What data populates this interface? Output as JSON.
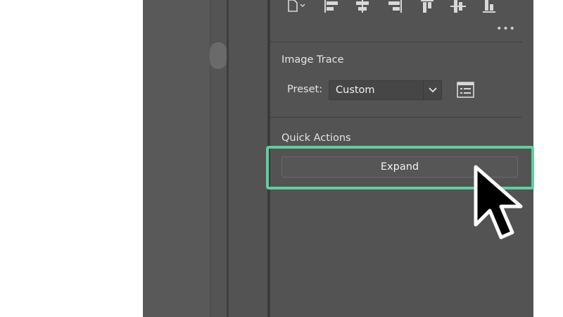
{
  "panel": {
    "more_icon_glyph": "•••",
    "image_trace": {
      "title": "Image Trace",
      "preset_label": "Preset:",
      "preset_value": "Custom"
    },
    "quick_actions": {
      "title": "Quick Actions",
      "expand_label": "Expand"
    }
  },
  "colors": {
    "panel_bg": "#535353",
    "highlight": "#5fcf9d",
    "text": "#e4e4e4"
  }
}
